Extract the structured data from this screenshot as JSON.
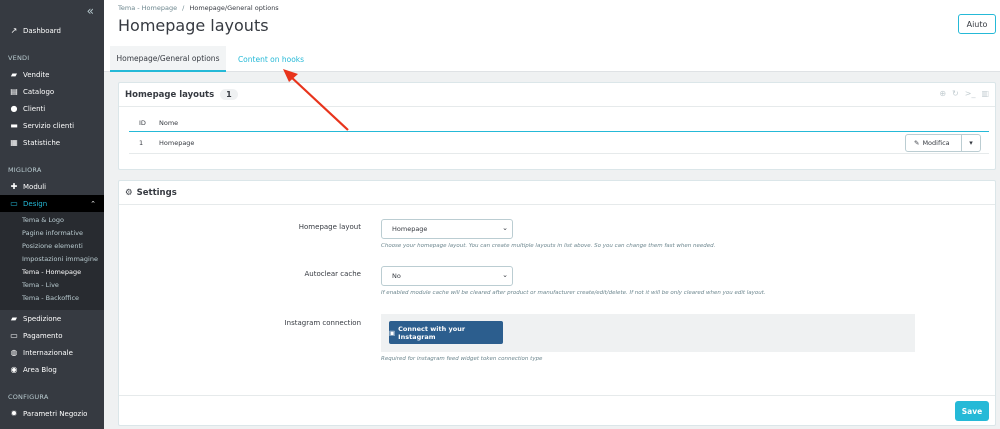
{
  "sidebar": {
    "collapse_icon": "double-chevron-left-icon",
    "dashboard": "Dashboard",
    "section_sell": "VENDI",
    "orders": "Vendite",
    "catalog": "Catalogo",
    "customers": "Clienti",
    "customer_service": "Servizio clienti",
    "stats": "Statistiche",
    "section_improve": "MIGLIORA",
    "modules": "Moduli",
    "design": "Design",
    "design_sub": [
      "Tema & Logo",
      "Pagine informative",
      "Posizione elementi",
      "Impostazioni immagine",
      "Tema - Homepage",
      "Tema - Live",
      "Tema - Backoffice"
    ],
    "shipping": "Spedizione",
    "payment": "Pagamento",
    "international": "Internazionale",
    "blog": "Area Blog",
    "section_configure": "CONFIGURA",
    "shop_params": "Parametri Negozio"
  },
  "header": {
    "breadcrumb_parent": "Tema - Homepage",
    "breadcrumb_separator": "/",
    "breadcrumb_current": "Homepage/General options",
    "title": "Homepage layouts",
    "help_button": "Aiuto",
    "tabs": [
      "Homepage/General options",
      "Content on hooks"
    ]
  },
  "layouts_panel": {
    "title": "Homepage layouts",
    "count": "1",
    "columns": [
      "ID",
      "Nome"
    ],
    "rows": [
      {
        "id": "1",
        "name": "Homepage"
      }
    ],
    "edit_button": "Modifica"
  },
  "settings_panel": {
    "title": "Settings",
    "homepage_layout_label": "Homepage layout",
    "homepage_layout_value": "Homepage",
    "homepage_layout_help": "Choose your homepage layout. You can create multiple layouts in list above. So you can change them fast when needed.",
    "autoclear_label": "Autoclear cache",
    "autoclear_value": "No",
    "autoclear_help": "If enabled module cache will be cleared after product or manufacturer create/edit/delete. If not it will be only cleared when you edit layout.",
    "instagram_label": "Instagram connection",
    "instagram_button": "Connect with your Instagram",
    "instagram_help": "Required for instagram feed widget token connection type",
    "save_button": "Save"
  },
  "colors": {
    "accent": "#25b9d7",
    "sidebar_bg": "#363a41",
    "instagram_btn": "#2c5e8e",
    "annotation_arrow": "#e8341c"
  }
}
